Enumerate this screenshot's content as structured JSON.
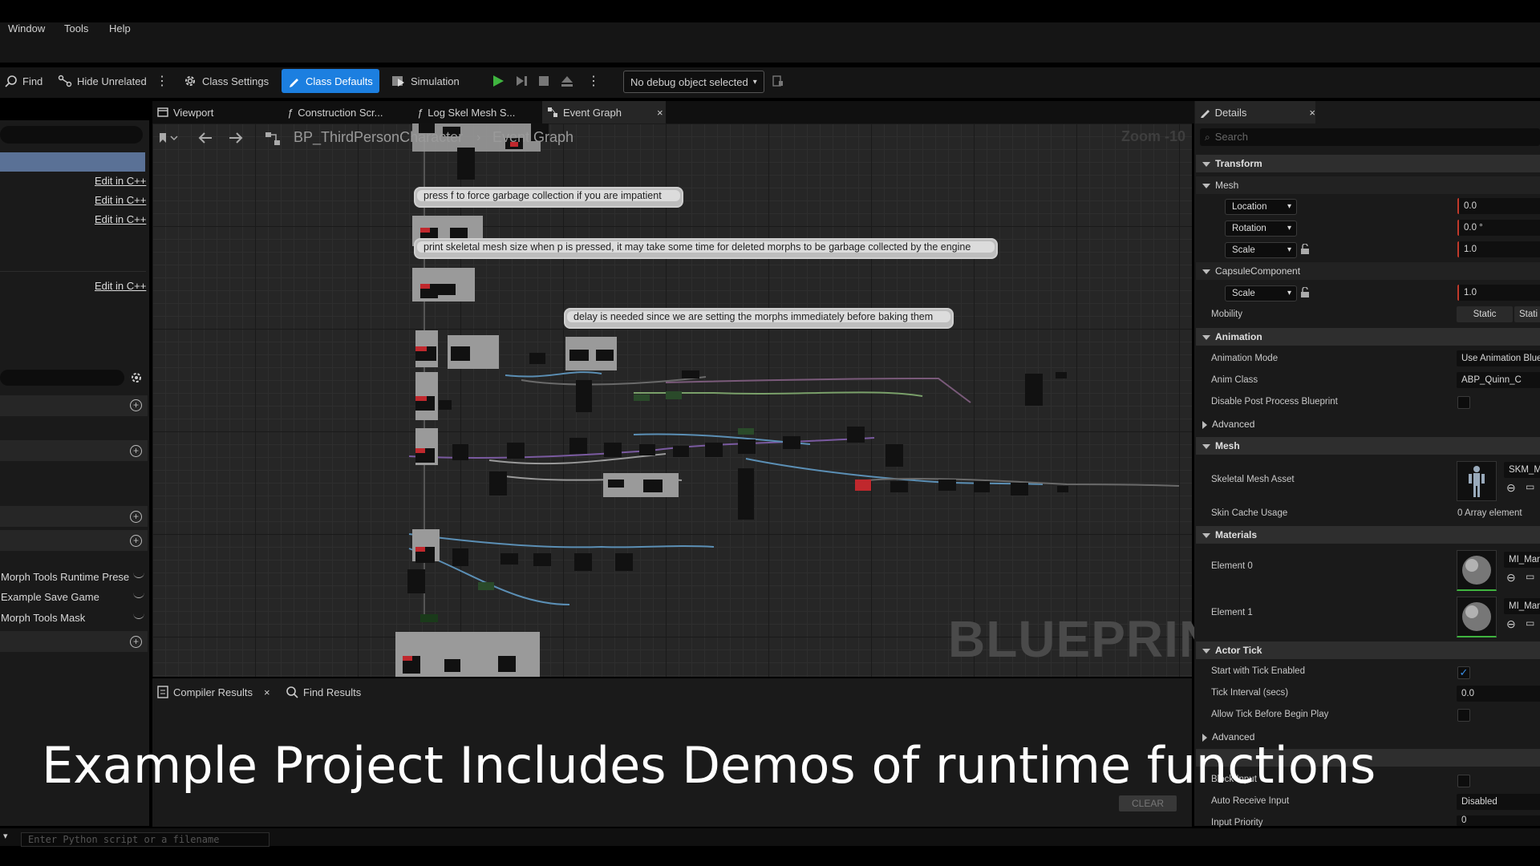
{
  "menu": {
    "window": "Window",
    "tools": "Tools",
    "help": "Help"
  },
  "toolbar": {
    "find": "Find",
    "hide_unrelated": "Hide Unrelated",
    "class_settings": "Class Settings",
    "class_defaults": "Class Defaults",
    "simulation": "Simulation",
    "debug_object": "No debug object selected"
  },
  "left_panel": {
    "edit_cpp": [
      "Edit in C++",
      "Edit in C++",
      "Edit in C++",
      "Edit in C++"
    ],
    "variables": [
      "Morph Tools Runtime Prese",
      "Example Save Game",
      "Morph Tools Mask"
    ]
  },
  "tabs": {
    "viewport": "Viewport",
    "construction": "Construction Scr...",
    "log_skel": "Log Skel Mesh S...",
    "event_graph": "Event Graph"
  },
  "graph": {
    "breadcrumb_blueprint": "BP_ThirdPersonCharacter",
    "breadcrumb_graph": "Event Graph",
    "zoom": "Zoom -10",
    "watermark": "BLUEPRINT",
    "comments": [
      "press f to force garbage collection if you are impatient",
      "print skeletal mesh size when p is pressed, it may take some time for deleted morphs to be garbage collected by the engine",
      "delay is needed since we are setting the morphs immediately before baking them"
    ]
  },
  "bottom": {
    "compiler_results": "Compiler Results",
    "find_results": "Find Results",
    "clear": "CLEAR",
    "python_placeholder": "Enter Python script or a filename"
  },
  "overlay_caption": "Example Project Includes Demos of runtime functions",
  "details": {
    "title": "Details",
    "search_placeholder": "Search",
    "transform": "Transform",
    "mesh_sub": "Mesh",
    "location": "Location",
    "location_val": "0.0",
    "rotation": "Rotation",
    "rotation_val": "0.0 °",
    "scale": "Scale",
    "scale_val": "1.0",
    "capsule": "CapsuleComponent",
    "capsule_scale": "Scale",
    "capsule_scale_val": "1.0",
    "mobility": "Mobility",
    "mobility_static": "Static",
    "mobility_static2": "Stati",
    "animation": "Animation",
    "anim_mode": "Animation Mode",
    "anim_mode_val": "Use Animation Blue",
    "anim_class": "Anim Class",
    "anim_class_val": "ABP_Quinn_C",
    "disable_pp": "Disable Post Process Blueprint",
    "advanced": "Advanced",
    "mesh": "Mesh",
    "skel_asset": "Skeletal Mesh Asset",
    "skel_asset_val": "SKM_M",
    "skin_cache": "Skin Cache Usage",
    "skin_cache_val": "0 Array element",
    "materials": "Materials",
    "element0": "Element 0",
    "element0_val": "MI_Man",
    "element1": "Element 1",
    "element1_val": "MI_Man",
    "actor_tick": "Actor Tick",
    "start_tick": "Start with Tick Enabled",
    "tick_interval": "Tick Interval (secs)",
    "tick_interval_val": "0.0",
    "allow_tick": "Allow Tick Before Begin Play",
    "advanced2": "Advanced",
    "block_input": "Block Input",
    "auto_receive": "Auto Receive Input",
    "auto_receive_val": "Disabled",
    "input_priority": "Input Priority",
    "input_priority_val": "0"
  },
  "colors": {
    "accent": "#1c7fe0",
    "selection": "#5a7196",
    "panel": "#1a1a1a",
    "graph_bg": "#262626"
  }
}
